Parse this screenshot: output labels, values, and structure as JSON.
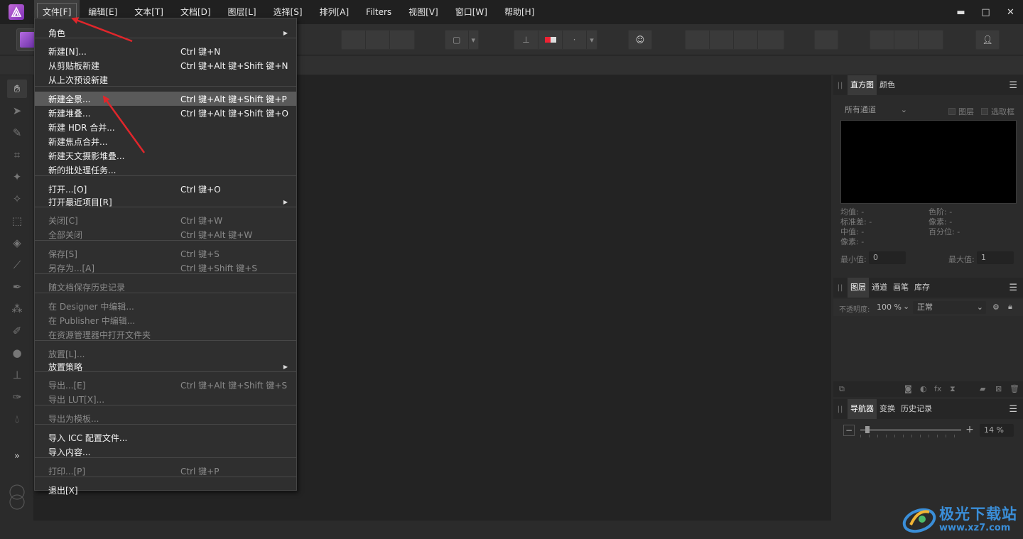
{
  "menubar": {
    "items": [
      "文件[F]",
      "编辑[E]",
      "文本[T]",
      "文档[D]",
      "图层[L]",
      "选择[S]",
      "排列[A]",
      "Filters",
      "视图[V]",
      "窗口[W]",
      "帮助[H]"
    ],
    "active_index": 0
  },
  "file_menu": {
    "items": [
      {
        "label": "角色",
        "submenu": true,
        "enabled": true
      },
      {
        "label": "新建[N]...",
        "shortcut": "Ctrl 键+N",
        "enabled": true
      },
      {
        "label": "从剪贴板新建",
        "shortcut": "Ctrl 键+Alt 键+Shift 键+N",
        "enabled": true
      },
      {
        "label": "从上次预设新建",
        "enabled": true
      },
      {
        "label": "新建全景...",
        "shortcut": "Ctrl 键+Alt 键+Shift 键+P",
        "enabled": true,
        "highlighted": true
      },
      {
        "label": "新建堆叠...",
        "shortcut": "Ctrl 键+Alt 键+Shift 键+O",
        "enabled": true
      },
      {
        "label": "新建 HDR 合并...",
        "enabled": true
      },
      {
        "label": "新建焦点合并...",
        "enabled": true
      },
      {
        "label": "新建天文摄影堆叠...",
        "enabled": true
      },
      {
        "label": "新的批处理任务...",
        "enabled": true
      },
      {
        "label": "打开...[O]",
        "shortcut": "Ctrl 键+O",
        "enabled": true
      },
      {
        "label": "打开最近项目[R]",
        "submenu": true,
        "enabled": true
      },
      {
        "label": "关闭[C]",
        "shortcut": "Ctrl 键+W",
        "enabled": false
      },
      {
        "label": "全部关闭",
        "shortcut": "Ctrl 键+Alt 键+W",
        "enabled": false
      },
      {
        "label": "保存[S]",
        "shortcut": "Ctrl 键+S",
        "enabled": false
      },
      {
        "label": "另存为...[A]",
        "shortcut": "Ctrl 键+Shift 键+S",
        "enabled": false
      },
      {
        "label": "随文档保存历史记录",
        "enabled": false
      },
      {
        "label": "在 Designer 中编辑...",
        "enabled": false
      },
      {
        "label": "在 Publisher 中编辑...",
        "enabled": false
      },
      {
        "label": "在资源管理器中打开文件夹",
        "enabled": false
      },
      {
        "label": "放置[L]...",
        "enabled": false
      },
      {
        "label": "放置策略",
        "submenu": true,
        "enabled": true
      },
      {
        "label": "导出...[E]",
        "shortcut": "Ctrl 键+Alt 键+Shift 键+S",
        "enabled": false
      },
      {
        "label": "导出 LUT[X]...",
        "enabled": false
      },
      {
        "label": "导出为模板...",
        "enabled": false
      },
      {
        "label": "导入 ICC 配置文件...",
        "enabled": true
      },
      {
        "label": "导入内容...",
        "enabled": true
      },
      {
        "label": "打印...[P]",
        "shortcut": "Ctrl 键+P",
        "enabled": false
      },
      {
        "label": "退出[X]",
        "enabled": true
      }
    ]
  },
  "histogram_panel": {
    "tabs": [
      "直方图",
      "颜色"
    ],
    "channel_select": "所有通道",
    "layer_checkbox": "图层",
    "marquee_checkbox": "选取框",
    "stats_left": [
      "均值: -",
      "标准差: -",
      "中值: -",
      "像素: -"
    ],
    "stats_right": [
      "色阶: -",
      "像素: -",
      "百分位: -"
    ],
    "min_label": "最小值:",
    "min_value": "0",
    "max_label": "最大值:",
    "max_value": "1"
  },
  "layers_panel": {
    "tabs": [
      "图层",
      "通道",
      "画笔",
      "库存"
    ],
    "opacity_label": "不透明度:",
    "opacity_value": "100 %",
    "blend_mode": "正常"
  },
  "navigator_panel": {
    "tabs": [
      "导航器",
      "变换",
      "历史记录"
    ],
    "zoom": "14 %",
    "zoom_fraction": 0.05
  },
  "watermark": {
    "title": "极光下载站",
    "url": "www.xz7.com"
  },
  "colors": {
    "accent_arrow": "#e0262b",
    "watermark": "#3a8ed8"
  }
}
